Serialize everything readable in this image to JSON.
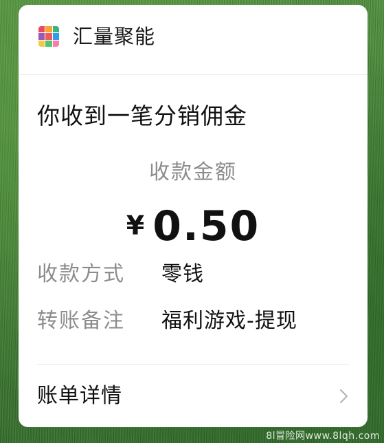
{
  "app": {
    "name": "汇量聚能",
    "logo_colors": [
      "#e84a5f",
      "#f7a531",
      "#3fb27f",
      "#9b59b6",
      "#f15a5a",
      "#2f9ee8",
      "#f2c94c",
      "#56c271",
      "#ff7aa8"
    ]
  },
  "notification": {
    "title": "你收到一笔分销佣金",
    "amount_label": "收款金额",
    "currency_symbol": "¥",
    "amount": "0.50",
    "fields": [
      {
        "label": "收款方式",
        "value": "零钱"
      },
      {
        "label": "转账备注",
        "value": "福利游戏-提现"
      }
    ],
    "details_label": "账单详情"
  },
  "icons": {
    "logo": "grid-logo-icon",
    "details": "chevron-right-icon"
  },
  "watermark": "8l冒险网www.8lqh.com"
}
